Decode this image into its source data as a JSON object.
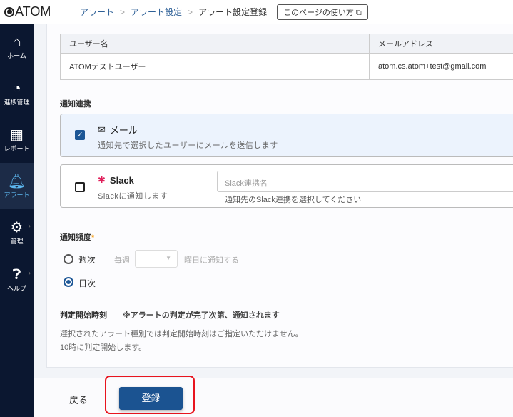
{
  "header": {
    "logo": "ATOM",
    "breadcrumb": [
      "アラート",
      "アラート設定",
      "アラート設定登録"
    ],
    "help_link": "このページの使い方"
  },
  "sidebar": {
    "items": [
      {
        "label": "ホーム",
        "icon": "home-icon"
      },
      {
        "label": "進捗管理",
        "icon": "progress-icon"
      },
      {
        "label": "レポート",
        "icon": "report-icon"
      },
      {
        "label": "アラート",
        "icon": "bell-icon"
      },
      {
        "label": "管理",
        "icon": "gear-icon"
      },
      {
        "label": "ヘルプ",
        "icon": "help-icon"
      }
    ]
  },
  "table": {
    "headers": [
      "ユーザー名",
      "メールアドレス"
    ],
    "rows": [
      [
        "ATOMテストユーザー",
        "atom.cs.atom+test@gmail.com"
      ]
    ]
  },
  "notify": {
    "title": "通知連携",
    "mail": {
      "label": "メール",
      "desc": "通知先で選択したユーザーにメールを送信します",
      "checked": true
    },
    "slack": {
      "label": "Slack",
      "desc": "Slackに通知します",
      "checked": false,
      "placeholder": "Slack連携名",
      "hint": "通知先のSlack連携を選択してください"
    }
  },
  "frequency": {
    "title": "通知頻度",
    "required": "*",
    "weekly": "週次",
    "every_week": "毎週",
    "weekday_suffix": "曜日に通知する",
    "daily": "日次",
    "selected": "日次"
  },
  "start": {
    "title": "判定開始時刻",
    "note": "※アラートの判定が完了次第、通知されます",
    "desc1": "選択されたアラート種別では判定開始時刻はご指定いただけません。",
    "desc2": "10時に判定開始します。"
  },
  "footer": {
    "back": "戻る",
    "submit": "登録"
  }
}
